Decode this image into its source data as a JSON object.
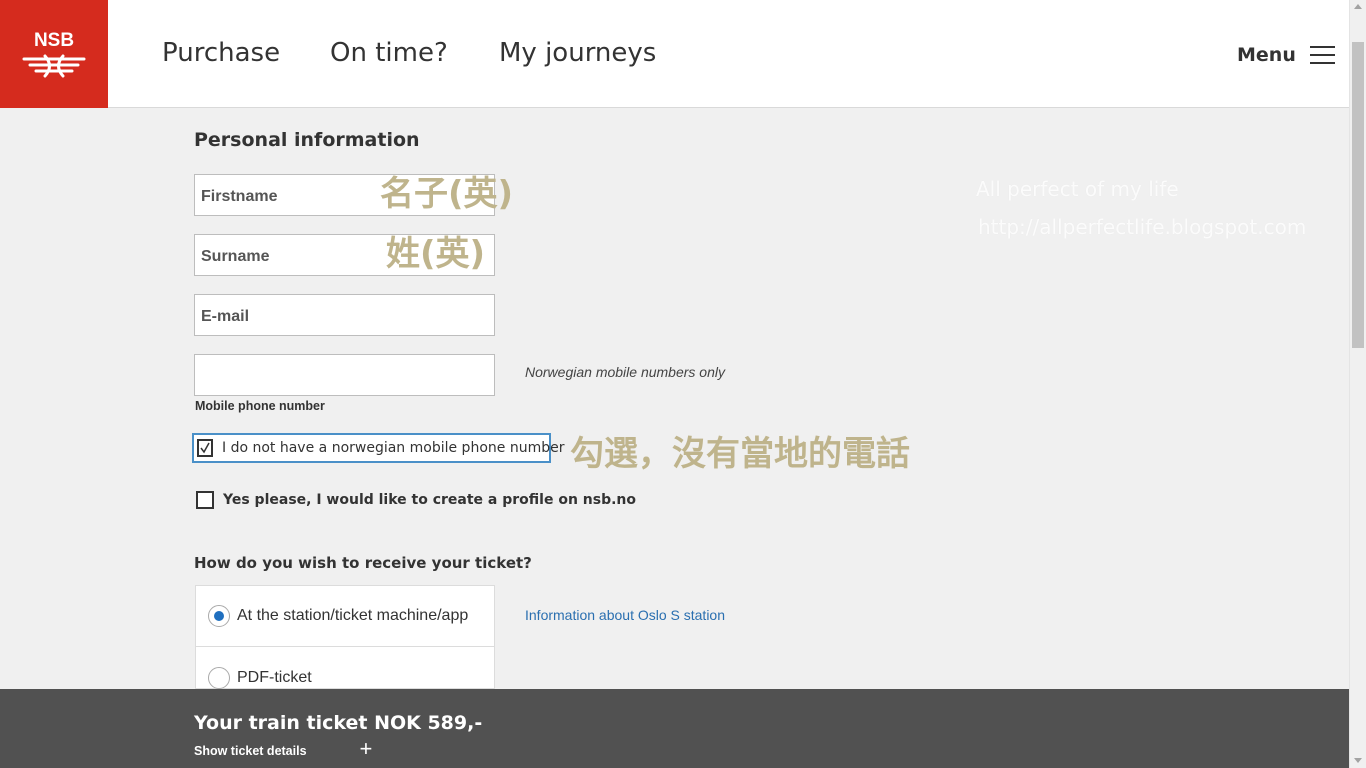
{
  "header": {
    "logo_text": "NSB",
    "nav": [
      "Purchase",
      "On time?",
      "My journeys"
    ],
    "menu_label": "Menu",
    "brand_color": "#d52b1e"
  },
  "form": {
    "title": "Personal information",
    "firstname_placeholder": "Firstname",
    "surname_placeholder": "Surname",
    "email_placeholder": "E-mail",
    "phone_value": "",
    "phone_label": "Mobile phone number",
    "phone_note": "Norwegian mobile numbers only",
    "no_mobile_label": "I do not have a norwegian mobile phone number",
    "no_mobile_checked": true,
    "profile_label": "Yes please, I would like to create a profile on nsb.no",
    "profile_checked": false
  },
  "delivery": {
    "title": "How do you wish to receive your ticket?",
    "options": [
      {
        "label": "At the station/ticket machine/app",
        "selected": true
      },
      {
        "label": "PDF-ticket",
        "selected": false
      }
    ],
    "info_link": "Information about Oslo S station"
  },
  "annotations": {
    "firstname": "名子(英)",
    "surname": "姓(英)",
    "no_mobile": "勾選，沒有當地的電話"
  },
  "watermark": {
    "line1": "All perfect of my life",
    "line2": "http://allperfectlife.blogspot.com"
  },
  "footer": {
    "price": "Your train ticket NOK 589,-",
    "details_label": "Show ticket details",
    "details_icon": "plus-icon"
  },
  "colors": {
    "accent_blue": "#1f6fbf",
    "link_blue": "#2a6fb0",
    "footer_bg": "#515151",
    "annotation": "#bfb48c"
  }
}
